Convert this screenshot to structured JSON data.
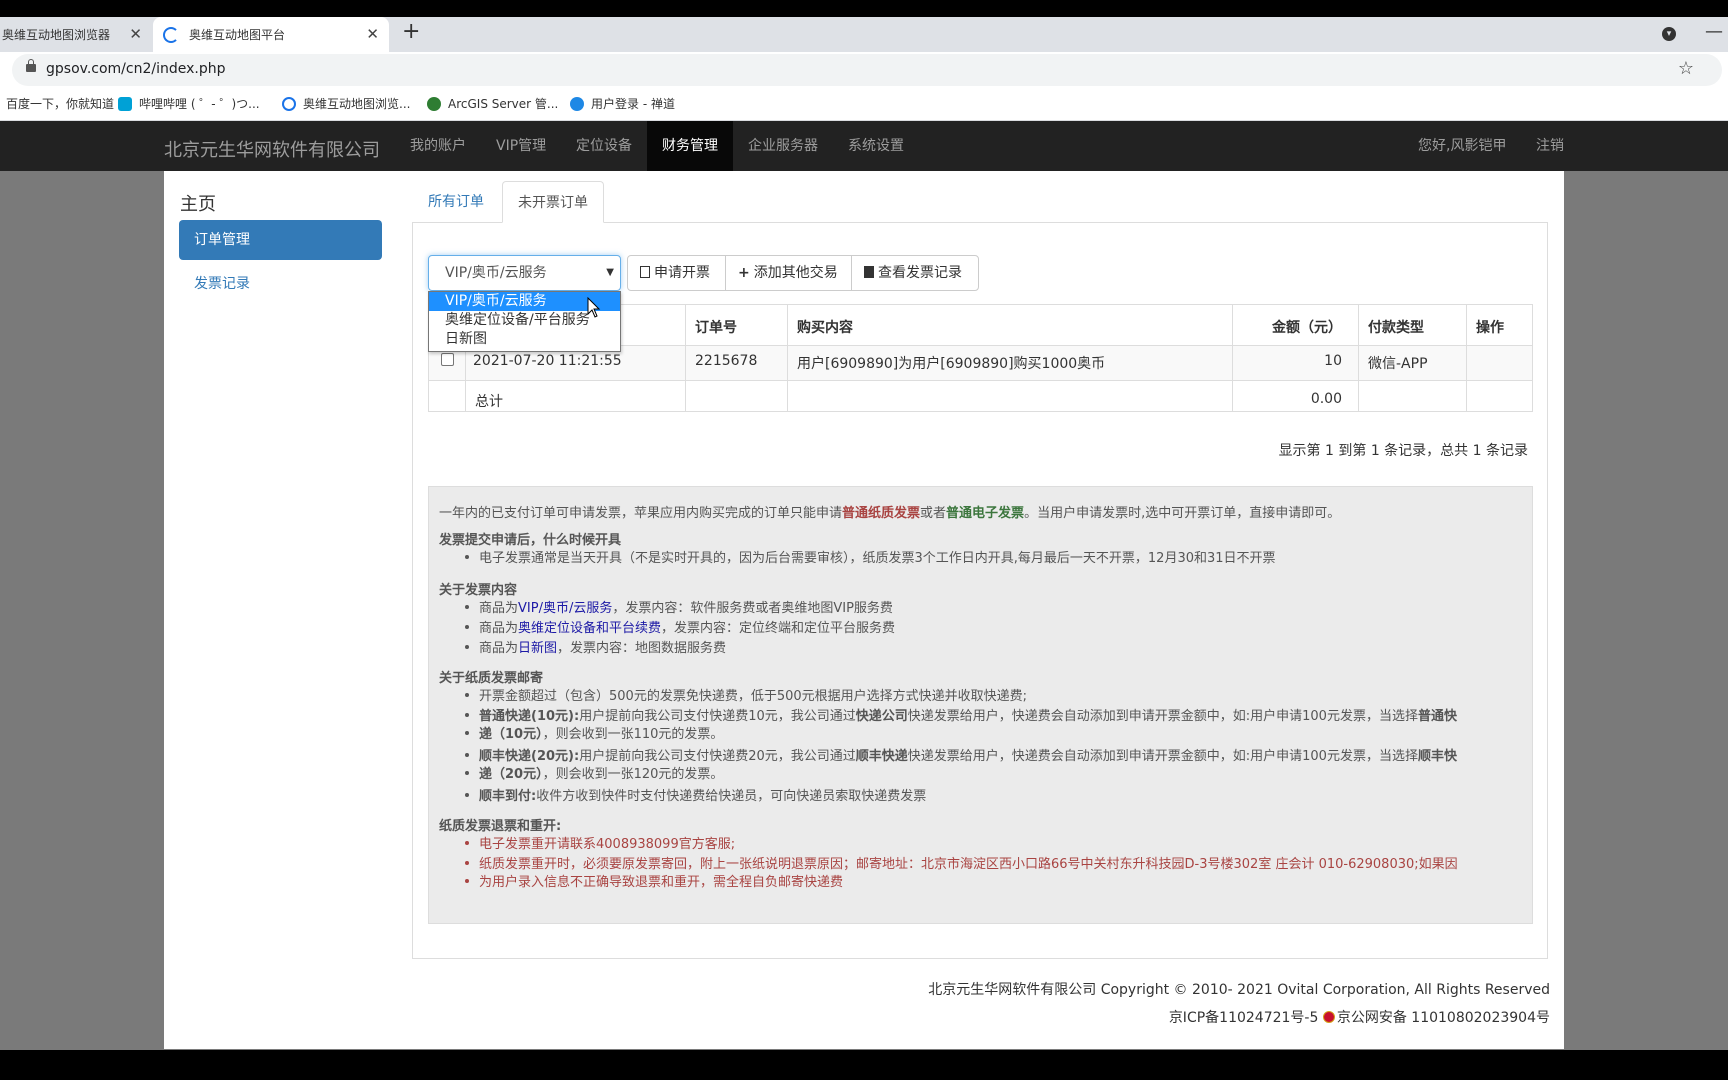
{
  "browser": {
    "tabs": [
      {
        "title": "奥维互动地图浏览器",
        "close": "✕"
      },
      {
        "title": "奥维互动地图平台",
        "close": "✕"
      }
    ],
    "new_tab": "+",
    "minimize": "—",
    "url": "gpsov.com/cn2/index.php",
    "bookmarks": [
      "百度一下，你就知道",
      "哔哩哔哩 ( ゜- ゜)つ...",
      "奥维互动地图浏览...",
      "ArcGIS Server 管...",
      "用户登录 - 禅道"
    ]
  },
  "navbar": {
    "brand": "北京元生华网软件有限公司",
    "items": [
      "我的账户",
      "VIP管理",
      "定位设备",
      "财务管理",
      "企业服务器",
      "系统设置"
    ],
    "active": "财务管理",
    "greeting": "您好,风影铠甲",
    "logout": "注销"
  },
  "sidebar": {
    "title": "主页",
    "items": [
      "订单管理",
      "发票记录"
    ]
  },
  "tabs": [
    "所有订单",
    "未开票订单"
  ],
  "toolbar": {
    "select_value": "VIP/奥币/云服务",
    "select_options": [
      "VIP/奥币/云服务",
      "奥维定位设备/平台服务",
      "日新图"
    ],
    "apply": "申请开票",
    "add": "添加其他交易",
    "view": "查看发票记录"
  },
  "table": {
    "headers": [
      "",
      "订单号",
      "购买内容",
      "金额（元）",
      "付款类型",
      "操作"
    ],
    "rows": [
      {
        "time": "2021-07-20 11:21:55",
        "order": "2215678",
        "content": "用户[6909890]为用户[6909890]购买1000奥币",
        "amount": "10",
        "pay": "微信-APP"
      }
    ],
    "total_label": "总计",
    "total_value": "0.00",
    "pagination": "显示第 1 到第 1 条记录，总共 1 条记录"
  },
  "notes": {
    "intro_a": "一年内的已支付订单可申请发票，苹果应用内购买完成的订单只能申请",
    "intro_paper": "普通纸质发票",
    "intro_or": "或者",
    "intro_elec": "普通电子发票",
    "intro_b": "。当用户申请发票时,选中可开票订单，直接申请即可。",
    "h1": "发票提交申请后，什么时候开具",
    "h1_item": "电子发票通常是当天开具（不是实时开具的，因为后台需要审核），纸质发票3个工作日内开具,每月最后一天不开票，12月30和31日不开票",
    "h2": "关于发票内容",
    "h2_items": [
      {
        "pre": "商品为",
        "hl": "VIP/奥币/云服务",
        "post": "，发票内容：软件服务费或者奥维地图VIP服务费"
      },
      {
        "pre": "商品为",
        "hl": "奥维定位设备和平台续费",
        "post": "，发票内容：定位终端和定位平台服务费"
      },
      {
        "pre": "商品为",
        "hl": "日新图",
        "post": "，发票内容：地图数据服务费"
      }
    ],
    "h3": "关于纸质发票邮寄",
    "h3_item1": "开票金额超过（包含）500元的发票免快递费，低于500元根据用户选择方式快递并收取快递费;",
    "h3_item2_b": "普通快递(10元):",
    "h3_item2_a": "用户提前向我公司支付快递费10元，我公司通过",
    "h3_item2_c": "快递公司",
    "h3_item2_d": "快递发票给用户，快递费会自动添加到申请开票金额中，如:用户申请100元发票，当选择",
    "h3_item2_e": "普通快",
    "h3_item2_f": "递（10元）",
    "h3_item2_g": "，则会收到一张110元的发票。",
    "h3_item3_b": "顺丰快递(20元):",
    "h3_item3_a": "用户提前向我公司支付快递费20元，我公司通过",
    "h3_item3_c": "顺丰快递",
    "h3_item3_d": "快递发票给用户，快递费会自动添加到申请开票金额中，如:用户申请100元发票，当选择",
    "h3_item3_e": "顺丰快",
    "h3_item3_f": "递（20元）",
    "h3_item3_g": "，则会收到一张120元的发票。",
    "h3_item4_b": "顺丰到付:",
    "h3_item4_a": "收件方收到快件时支付快递费给快递员，可向快递员索取快递费发票",
    "h4": "纸质发票退票和重开:",
    "h4_item1": "电子发票重开请联系4008938099官方客服;",
    "h4_item2_a": "纸质发票重开时，必须要原发票寄回，附上一张纸说明退票原因；邮寄地址：北京市海淀区西小口路66号中关村东升科技园D-3号楼302室 庄会计 010-62908030;如果因",
    "h4_item2_b": "为用户录入信息不正确导致退票和重开，需全程自负邮寄快递费"
  },
  "footer": {
    "copyright": "北京元生华网软件有限公司 Copyright © 2010- 2021 Ovital Corporation, All Rights Reserved",
    "icp": "京ICP备11024721号-5",
    "police": "京公网安备 11010802023904号"
  }
}
